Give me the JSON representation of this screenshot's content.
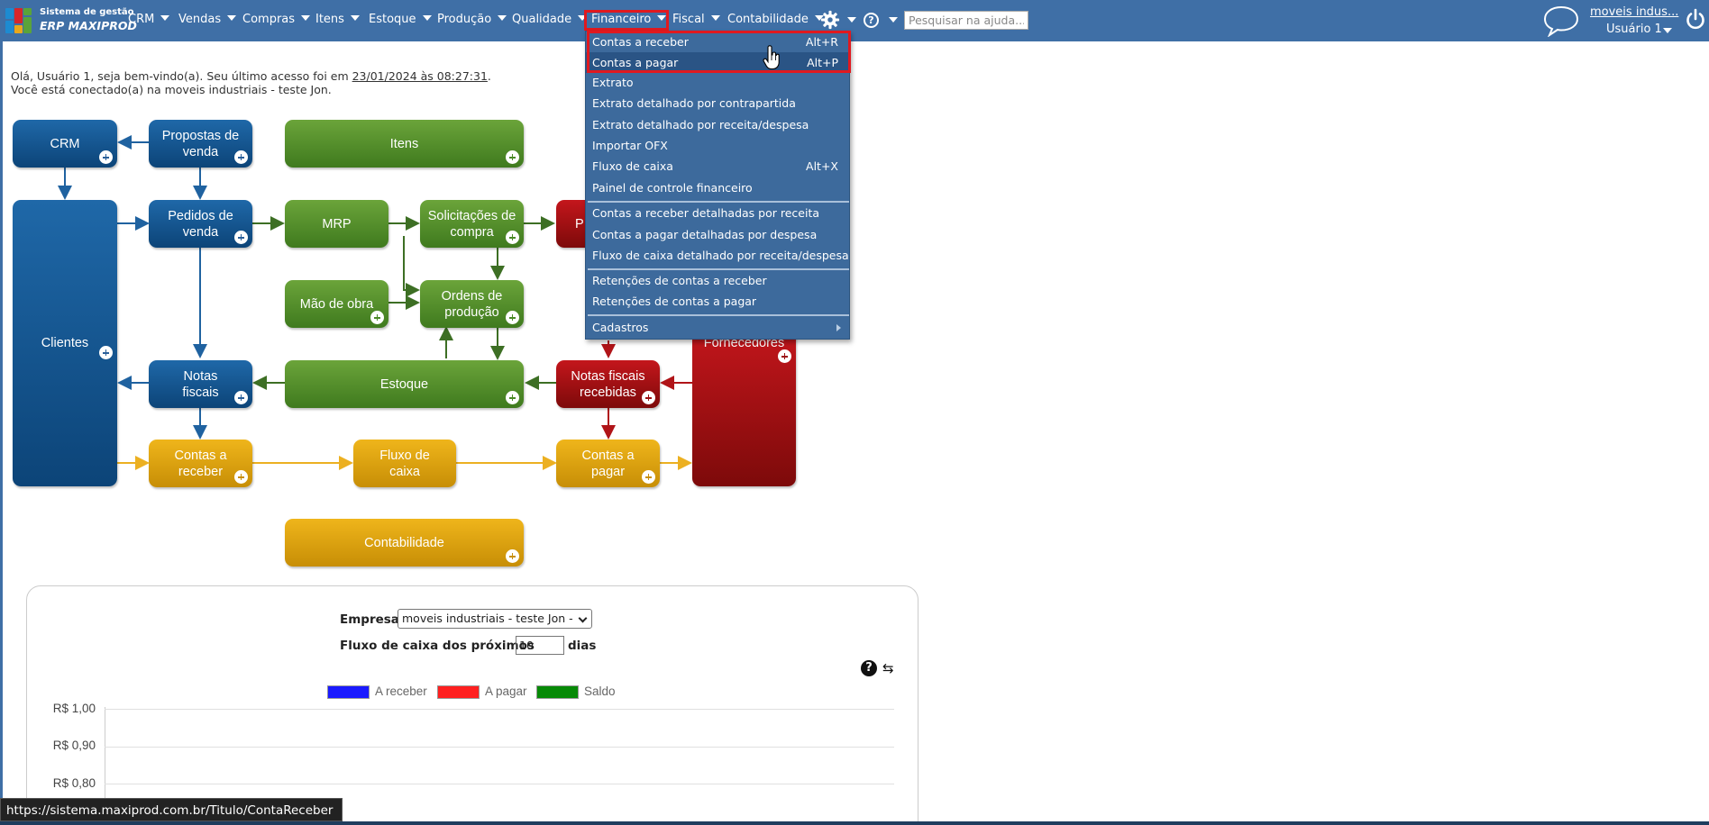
{
  "app": {
    "logo_line1": "Sistema de gestão",
    "logo_line2": "ERP MAXIPROD"
  },
  "nav": {
    "items": [
      {
        "label": "CRM"
      },
      {
        "label": "Vendas"
      },
      {
        "label": "Compras"
      },
      {
        "label": "Itens"
      },
      {
        "label": "Estoque"
      },
      {
        "label": "Produção"
      },
      {
        "label": "Qualidade"
      },
      {
        "label": "Financeiro",
        "active": true
      },
      {
        "label": "Fiscal"
      },
      {
        "label": "Contabilidade"
      }
    ],
    "settings_icon": "gear-icon",
    "help_icon": "question-circle-icon",
    "help_glyph": "?",
    "search_placeholder": "Pesquisar na ajuda..."
  },
  "user": {
    "company": "moveis indus...",
    "name": "Usuário 1",
    "chat_icon": "chat-bubble-icon",
    "power_icon": "power-icon"
  },
  "welcome": {
    "prefix": "Olá, Usuário 1, seja bem-vindo(a). Seu último acesso foi em ",
    "last_access": "23/01/2024 às 08:27:31",
    "suffix": ".",
    "line2": "Você está conectado(a) na moveis industriais - teste Jon."
  },
  "flow": {
    "crm": "CRM",
    "propostas1": "Propostas de",
    "propostas2": "venda",
    "itens": "Itens",
    "clientes": "Clientes",
    "pedidos1": "Pedidos de",
    "pedidos2": "venda",
    "mrp": "MRP",
    "solicitacoes1": "Solicitações de",
    "solicitacoes2": "compra",
    "pedidos_compra_partial": "P",
    "mao_de_obra": "Mão de obra",
    "ordens1": "Ordens de",
    "ordens2": "produção",
    "fornecedores": "Fornecedores",
    "notas1": "Notas",
    "notas2": "fiscais",
    "estoque": "Estoque",
    "nfr1": "Notas fiscais",
    "nfr2": "recebidas",
    "receber1": "Contas a",
    "receber2": "receber",
    "fluxo1": "Fluxo de",
    "fluxo2": "caixa",
    "pagar1": "Contas a",
    "pagar2": "pagar",
    "contabilidade": "Contabilidade"
  },
  "financeiro_menu": {
    "items": [
      {
        "label": "Contas a receber",
        "shortcut": "Alt+R"
      },
      {
        "label": "Contas a pagar",
        "shortcut": "Alt+P"
      },
      {
        "label": "Extrato",
        "shortcut": ""
      },
      {
        "label": "Extrato detalhado por contrapartida",
        "shortcut": ""
      },
      {
        "label": "Extrato detalhado por receita/despesa",
        "shortcut": ""
      },
      {
        "label": "Importar OFX",
        "shortcut": ""
      },
      {
        "label": "Fluxo de caixa",
        "shortcut": "Alt+X"
      },
      {
        "label": "Painel de controle financeiro",
        "shortcut": ""
      },
      {
        "label": "Contas a receber detalhadas por receita",
        "shortcut": ""
      },
      {
        "label": "Contas a pagar detalhadas por despesa",
        "shortcut": ""
      },
      {
        "label": "Fluxo de caixa detalhado por receita/despesa",
        "shortcut": ""
      },
      {
        "label": "Retenções de contas a receber",
        "shortcut": ""
      },
      {
        "label": "Retenções de contas a pagar",
        "shortcut": ""
      },
      {
        "label": "Cadastros",
        "shortcut": ""
      }
    ]
  },
  "cashflow": {
    "empresa_label": "Empresa",
    "empresa_value": "moveis industriais - teste Jon -",
    "proximos_label": "Fluxo de caixa dos próximos",
    "dias_value": "10",
    "dias_label": "dias",
    "help_glyph": "?",
    "refresh_glyph": "⇆",
    "legend": [
      {
        "label": "A receber",
        "color": "#1a1aff"
      },
      {
        "label": "A pagar",
        "color": "#ff2020"
      },
      {
        "label": "Saldo",
        "color": "#078a07"
      }
    ],
    "yticks": [
      "R$ 1,00",
      "R$ 0,90",
      "R$ 0,80"
    ]
  },
  "status_url": "https://sistema.maxiprod.com.br/Titulo/ContaReceber"
}
